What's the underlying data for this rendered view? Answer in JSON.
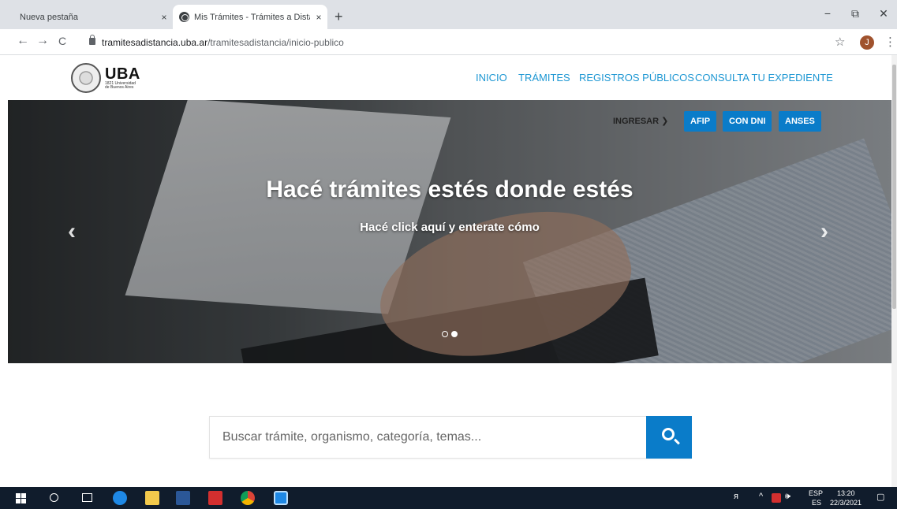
{
  "browser": {
    "tabs": [
      {
        "title": "Nueva pestaña",
        "active": false
      },
      {
        "title": "Mis Trámites - Trámites a Distanc",
        "active": true
      }
    ],
    "close_glyph": "×",
    "new_tab_glyph": "+",
    "window_controls": {
      "minimize": "−",
      "restore": "⧉",
      "close": "✕"
    },
    "back_glyph": "←",
    "forward_glyph": "→",
    "reload_glyph": "C",
    "url_host": "tramitesadistancia.uba.ar",
    "url_path": "/tramitesadistancia/inicio-publico",
    "bookmark_glyph": "☆",
    "profile_initial": "J",
    "menu_glyph": "⋮"
  },
  "site": {
    "logo": {
      "name": "UBA",
      "subtitle_line1": "1821 Universidad",
      "subtitle_line2": "de Buenos Aires"
    },
    "nav": [
      "INICIO",
      "TRÁMITES",
      "REGISTROS PÚBLICOS",
      "CONSULTA TU EXPEDIENTE"
    ],
    "accent_color": "#1d97d3"
  },
  "hero": {
    "title": "Hacé trámites estés donde estés",
    "subtitle": "Hacé click aquí y enterate cómo",
    "ingresar_label": "INGRESAR ❯",
    "login_buttons": [
      "AFIP",
      "CON DNI",
      "ANSES"
    ],
    "button_color": "#0a7cc9",
    "prev_glyph": "‹",
    "next_glyph": "›",
    "slides_total": 2,
    "active_slide": 2
  },
  "search": {
    "placeholder": "Buscar trámite, organismo, categoría, temas...",
    "button_icon": "search-icon"
  },
  "taskbar": {
    "tray_lang_top": "ESP",
    "tray_lang_bottom": "ES",
    "time": "13:20",
    "date": "22/3/2021",
    "tray_glyphs": {
      "people": "ᴙ",
      "chevron": "^",
      "volume": "🕪",
      "notifications": "▢"
    }
  }
}
